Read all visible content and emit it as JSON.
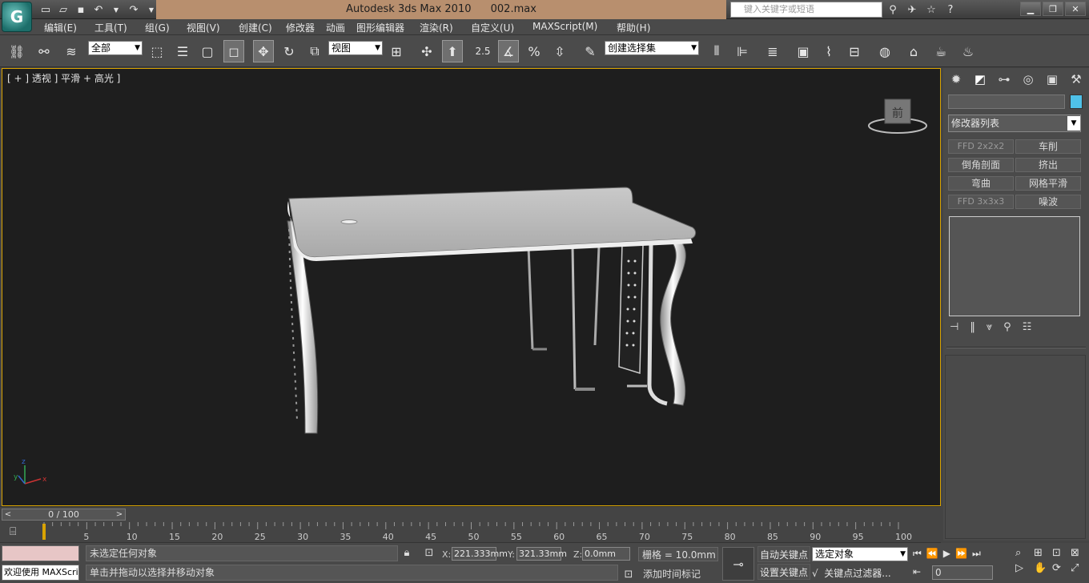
{
  "title": {
    "app": "Autodesk 3ds Max  2010",
    "file": "002.max",
    "search_placeholder": "键入关键字或短语"
  },
  "menu": [
    {
      "label": "编辑(E)"
    },
    {
      "label": "工具(T)"
    },
    {
      "label": "组(G)"
    },
    {
      "label": "视图(V)"
    },
    {
      "label": "创建(C)"
    },
    {
      "label": "修改器"
    },
    {
      "label": "动画"
    },
    {
      "label": "图形编辑器"
    },
    {
      "label": "渲染(R)"
    },
    {
      "label": "自定义(U)"
    },
    {
      "label": "MAXScript(M)"
    },
    {
      "label": "帮助(H)"
    }
  ],
  "toolbar": {
    "filter": "全部",
    "refcoord": "视图",
    "snap_label": "2.5",
    "named_selset": "创建选择集"
  },
  "viewport": {
    "label": "[ + ] 透视 ] 平滑 + 高光 ]",
    "viewcube_face": "前",
    "axis_x": "x",
    "axis_y": "y",
    "axis_z": "z"
  },
  "command_panel": {
    "modifier_list": "修改器列表",
    "modifiers": [
      "FFD 2x2x2",
      "车削",
      "倒角剖面",
      "挤出",
      "弯曲",
      "网格平滑",
      "FFD 3x3x3",
      "噪波"
    ],
    "swatch_color": "#4fc1e8"
  },
  "timeline": {
    "slider_label": "0 / 100",
    "prev": "<",
    "next": ">",
    "ticks": [
      "5",
      "10",
      "15",
      "20",
      "25",
      "30",
      "35",
      "40",
      "45",
      "50",
      "55",
      "60",
      "65",
      "70",
      "75",
      "80",
      "85",
      "90",
      "95",
      "100"
    ]
  },
  "status": {
    "welcome": "欢迎使用 MAXScri",
    "message": "未选定任何对象",
    "prompt": "单击并拖动以选择并移动对象",
    "x_label": "X:",
    "x_value": "221.333mm",
    "y_label": "Y:",
    "y_value": "321.33mm",
    "z_label": "Z:",
    "z_value": "0.0mm",
    "grid": "栅格 = 10.0mm",
    "add_time_tag": "添加时间标记",
    "auto_key": "自动关键点",
    "set_key": "设置关键点",
    "selected": "选定对象",
    "key_filters": "关键点过滤器...",
    "frame": "0"
  }
}
